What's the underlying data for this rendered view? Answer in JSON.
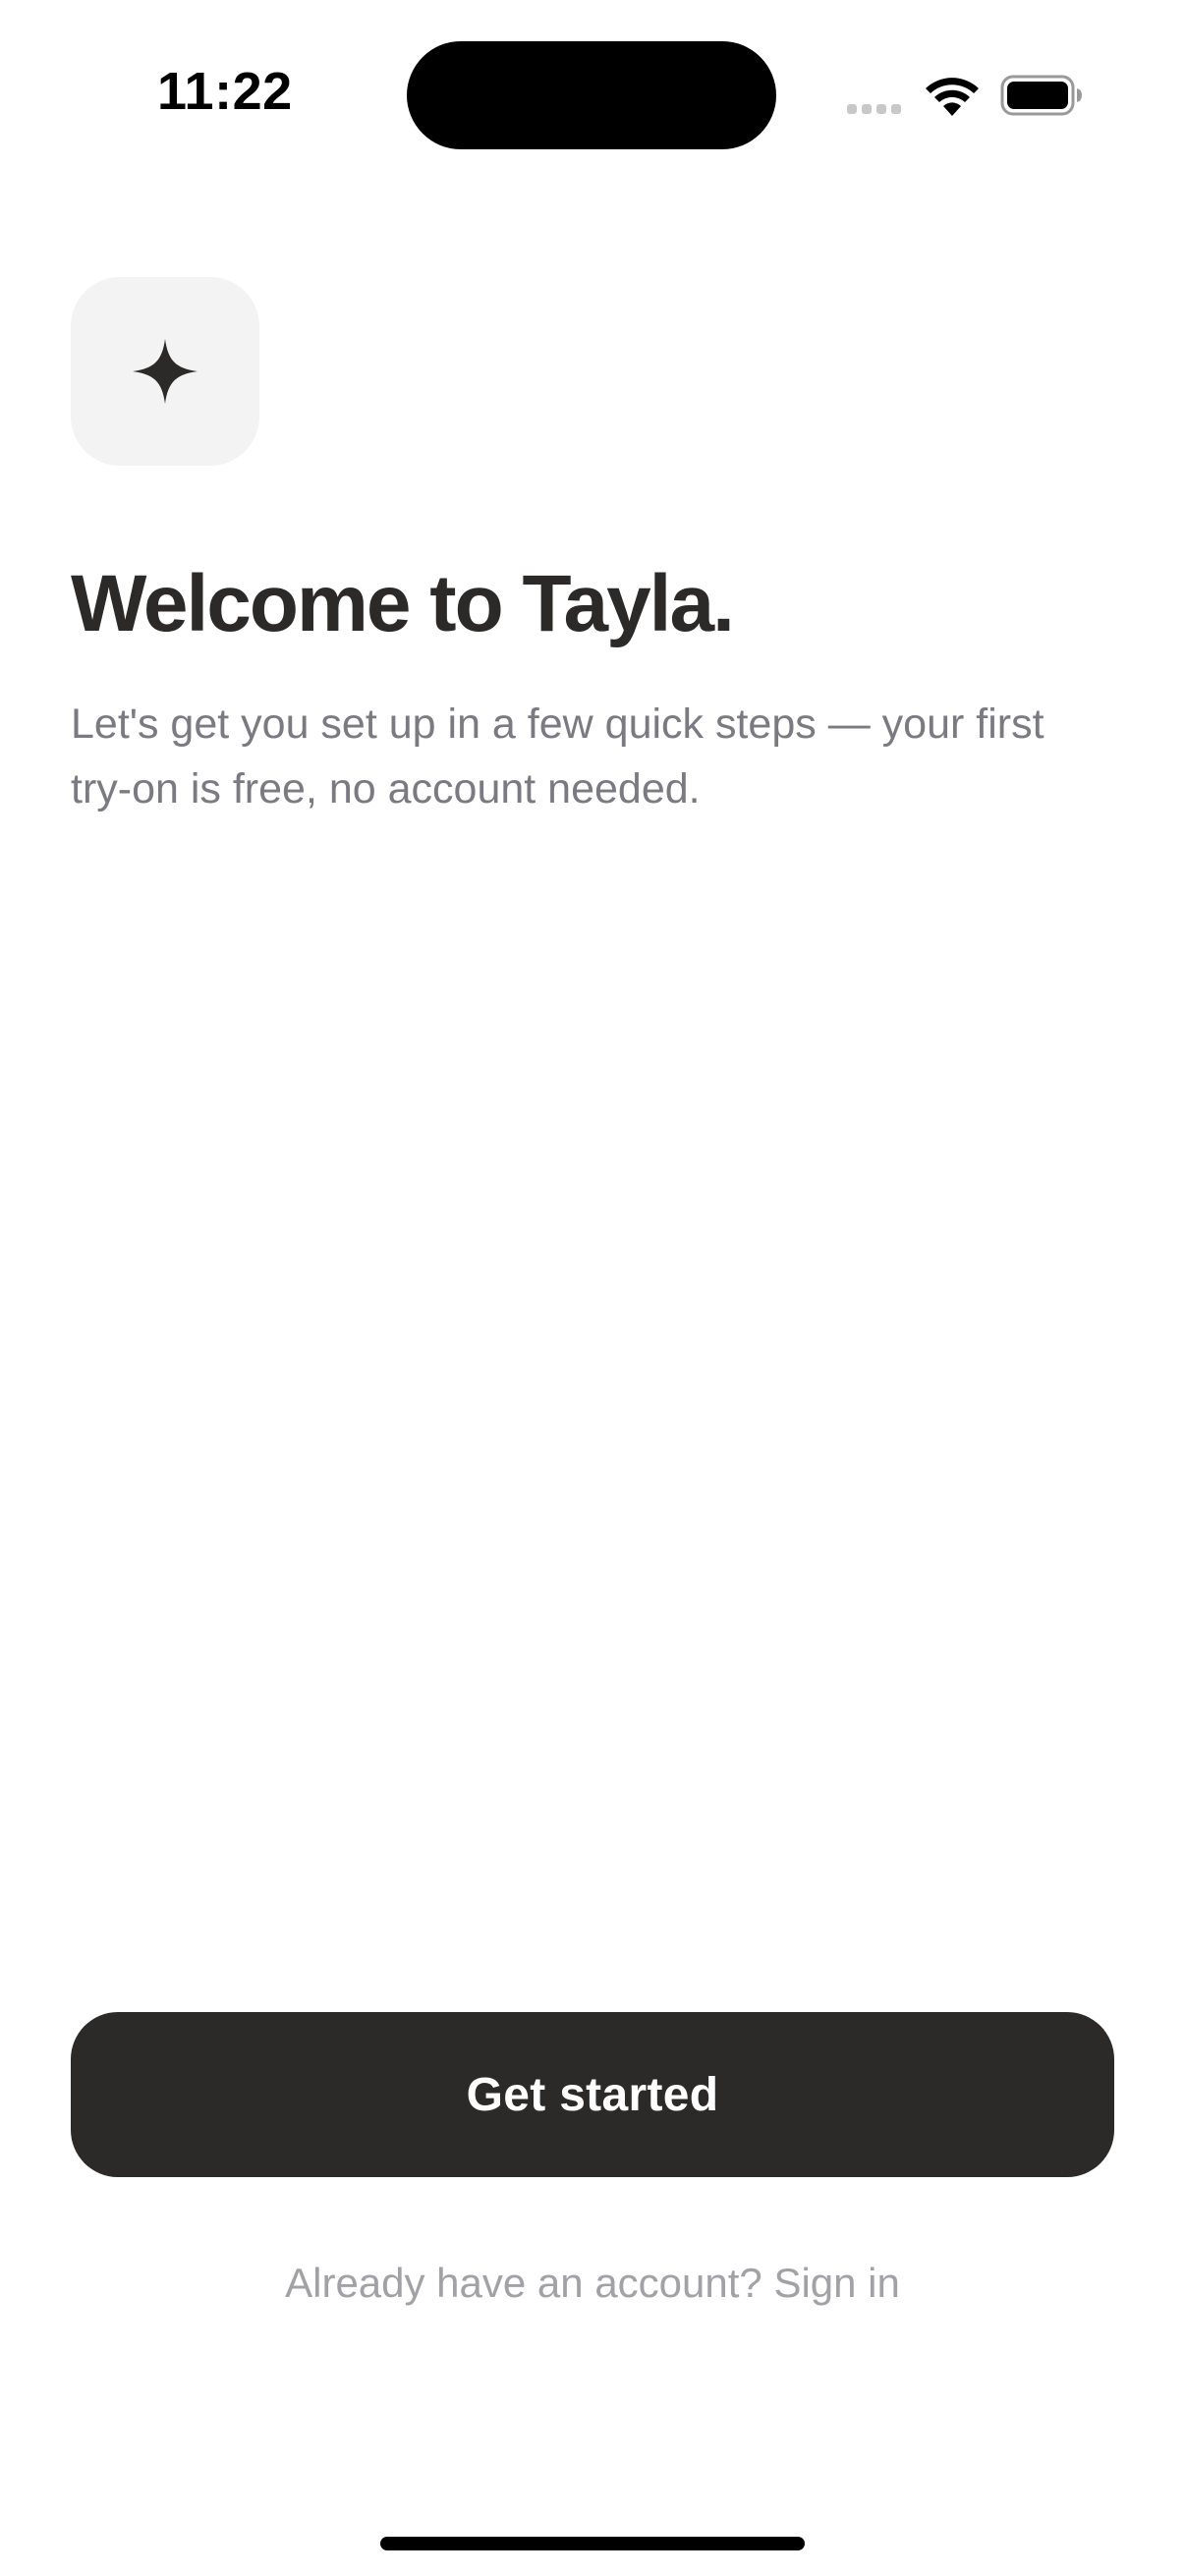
{
  "status_bar": {
    "time": "11:22",
    "icons": [
      "cellular-signal-icon",
      "wifi-icon",
      "battery-icon"
    ]
  },
  "onboarding": {
    "app_icon": "sparkle-icon",
    "title": "Welcome to Tayla.",
    "subtitle": "Let's get you set up in a few quick steps — your first try-on is free, no account needed.",
    "primary_button_label": "Get started",
    "sign_in_link": "Already have an account? Sign in"
  },
  "colors": {
    "primary": "#2b2a28",
    "subtitle_text": "#7b7a80",
    "link_text": "#a2a1a6",
    "tile_background": "#f3f3f3",
    "background": "#ffffff"
  }
}
